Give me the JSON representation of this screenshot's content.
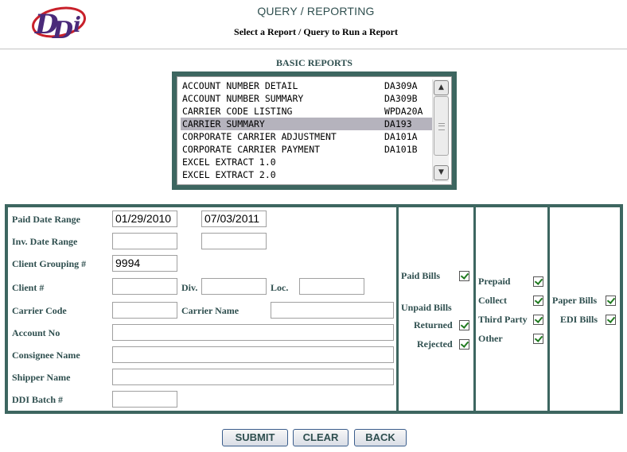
{
  "header": {
    "logo_text": "DDi",
    "title": "QUERY / REPORTING",
    "subtitle": "Select a Report / Query to Run a Report"
  },
  "reports": {
    "section_title": "BASIC REPORTS",
    "items": [
      {
        "name": "ACCOUNT NUMBER DETAIL",
        "code": "DA309A"
      },
      {
        "name": "ACCOUNT NUMBER SUMMARY",
        "code": "DA309B"
      },
      {
        "name": "CARRIER CODE LISTING",
        "code": "WPDA20A"
      },
      {
        "name": "CARRIER SUMMARY",
        "code": "DA193"
      },
      {
        "name": "CORPORATE CARRIER ADJUSTMENT",
        "code": "DA101A"
      },
      {
        "name": "CORPORATE CARRIER PAYMENT",
        "code": "DA101B"
      },
      {
        "name": "EXCEL EXTRACT 1.0",
        "code": ""
      },
      {
        "name": "EXCEL EXTRACT 2.0",
        "code": ""
      }
    ],
    "selected_index": 3
  },
  "form": {
    "paid_date_range_label": "Paid Date Range",
    "paid_date_from": "01/29/2010",
    "paid_date_to": "07/03/2011",
    "inv_date_range_label": "Inv. Date Range",
    "inv_date_from": "",
    "inv_date_to": "",
    "client_grouping_label": "Client Grouping #",
    "client_grouping_value": "9994",
    "client_label": "Client #",
    "client_value": "",
    "div_label": "Div.",
    "div_value": "",
    "loc_label": "Loc.",
    "loc_value": "",
    "carrier_code_label": "Carrier Code",
    "carrier_code_value": "",
    "carrier_name_label": "Carrier Name",
    "carrier_name_value": "",
    "account_no_label": "Account No",
    "account_no_value": "",
    "consignee_label": "Consignee Name",
    "consignee_value": "",
    "shipper_label": "Shipper Name",
    "shipper_value": "",
    "batch_label": "DDI Batch #",
    "batch_value": ""
  },
  "bill_status": {
    "paid_bills_label": "Paid Bills",
    "paid_bills_checked": true,
    "unpaid_bills_label": "Unpaid Bills",
    "returned_label": "Returned",
    "returned_checked": true,
    "rejected_label": "Rejected",
    "rejected_checked": true
  },
  "terms": {
    "prepaid_label": "Prepaid",
    "collect_label": "Collect",
    "third_party_label": "Third Party",
    "other_label": "Other",
    "all_checked": true
  },
  "bill_type": {
    "paper_bills_label": "Paper Bills",
    "edi_bills_label": "EDI Bills",
    "all_checked": true
  },
  "actions": {
    "submit_label": "SUBMIT",
    "clear_label": "CLEAR",
    "back_label": "BACK"
  },
  "colors": {
    "frame": "#3d6660",
    "label_text": "#2f4f4f",
    "selected_row": "#b5b3bd",
    "logo_red": "#c8202a",
    "logo_purple": "#4a2a7a"
  }
}
